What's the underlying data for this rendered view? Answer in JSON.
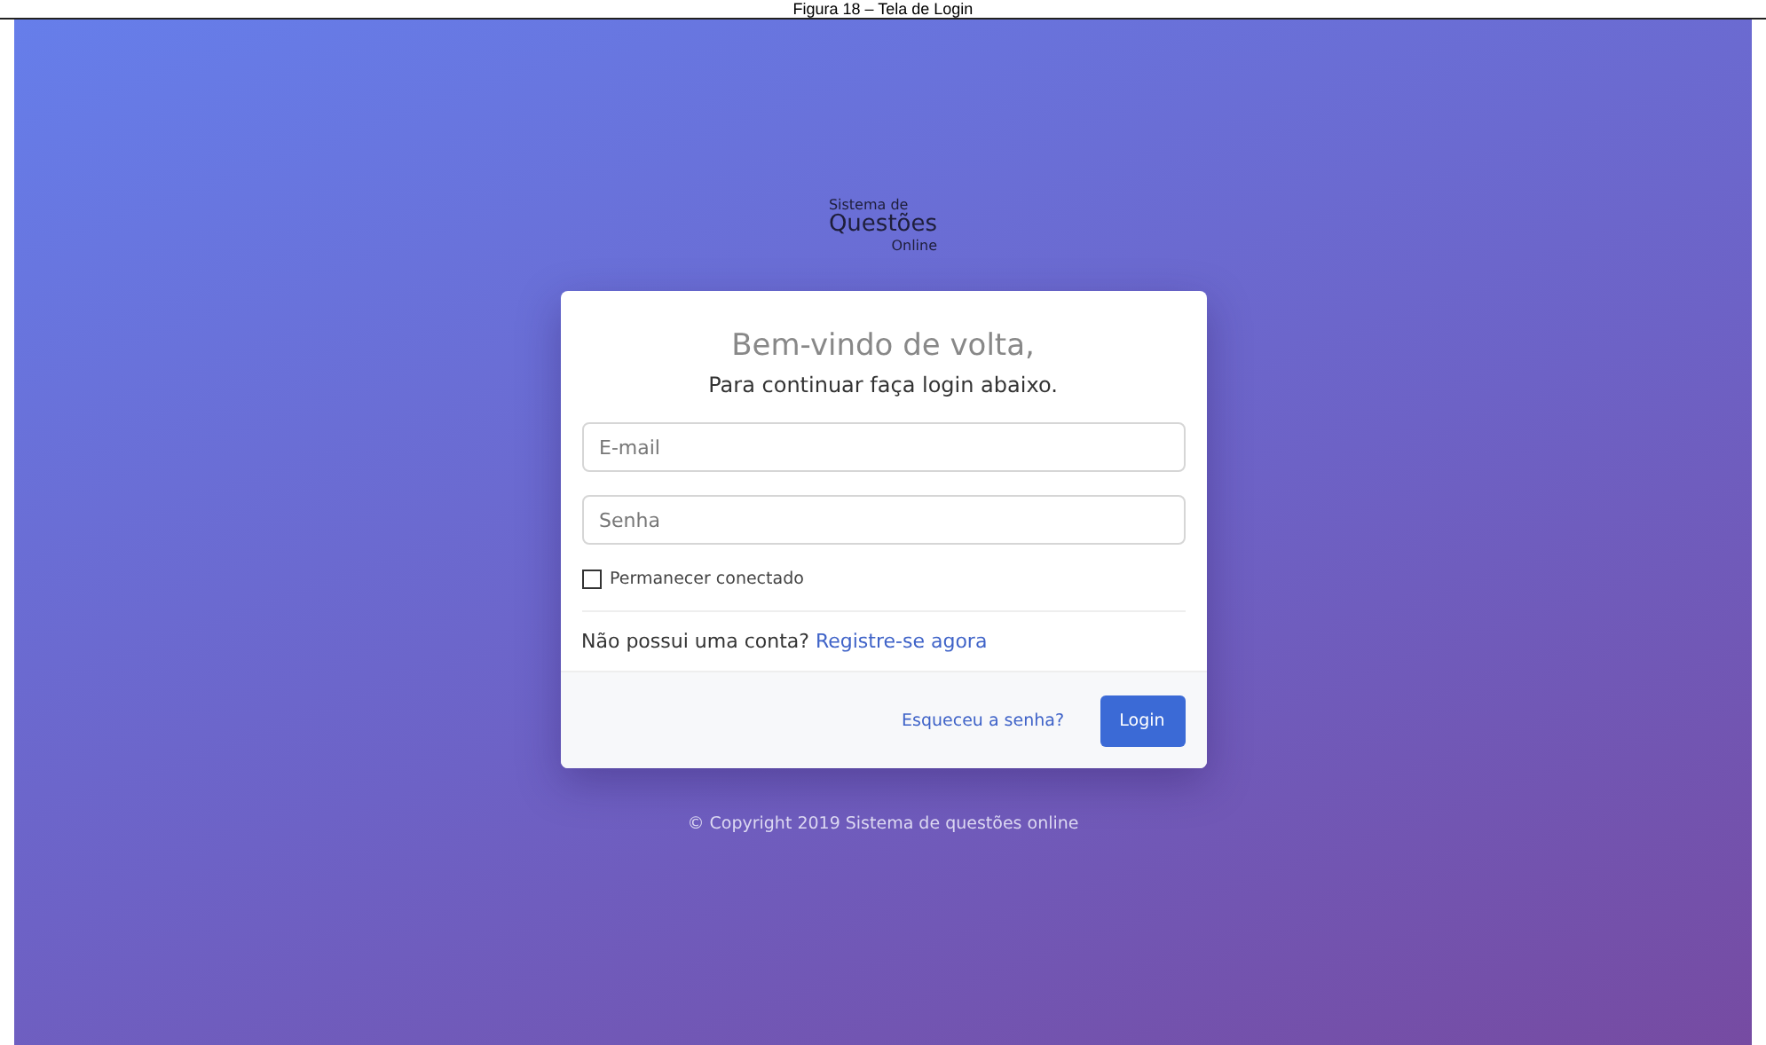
{
  "caption": "Figura 18 – Tela de Login",
  "logo": {
    "line_1": "Sistema de",
    "line_2": "Questões",
    "line_3": "Online"
  },
  "card": {
    "title": "Bem-vindo de volta,",
    "subtitle": "Para continuar faça login abaixo.",
    "fields": [
      {
        "placeholder": "E-mail"
      },
      {
        "placeholder": "Senha"
      }
    ],
    "remember": {
      "label": "Permanecer conectado",
      "checked": false
    },
    "signup_text": "Não possui uma conta?",
    "signup_link": "Registre-se agora",
    "forgot_link": "Esqueceu a senha?",
    "login_button": "Login"
  },
  "footer": "© Copyright 2019 Sistema de questões online"
}
